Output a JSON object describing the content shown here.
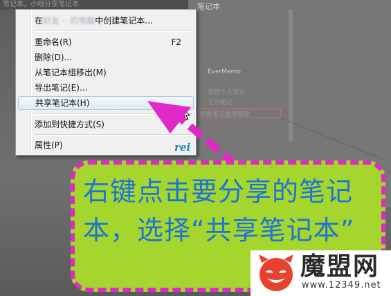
{
  "background": {
    "header_text": "笔记本，小组分享笔记本",
    "panel_title": "笔记本",
    "items": [
      {
        "text": "EverMemo"
      },
      {
        "text": "我的个人笔记"
      },
      {
        "text": "工作笔记"
      },
      {
        "text": "印象笔记使用教程"
      }
    ]
  },
  "context_menu": {
    "items": [
      {
        "prefix": "在",
        "blurred": "好友 ·· 的电脑",
        "suffix": "中创建笔记本...",
        "shortcut": ""
      },
      {
        "label": "重命名(R)",
        "shortcut": "F2"
      },
      {
        "label": "删除(D)..."
      },
      {
        "label": "从笔记本组移出(M)"
      },
      {
        "label": "导出笔记(E)..."
      },
      {
        "label": "共享笔记本(H)"
      },
      {
        "label": "添加到快捷方式(S)"
      },
      {
        "label": "属性(P)"
      }
    ],
    "watermark": "rei"
  },
  "callout": {
    "text": "右键点击要分享的笔记本，选择“共享笔记本”"
  },
  "logo": {
    "name": "魔盟网",
    "url": "www.12349.net"
  },
  "colors": {
    "accent_magenta": "#e02ac8",
    "callout_green": "#a4d62e",
    "callout_text": "#1e73d6",
    "menu_selected_border": "#aec6e2"
  }
}
